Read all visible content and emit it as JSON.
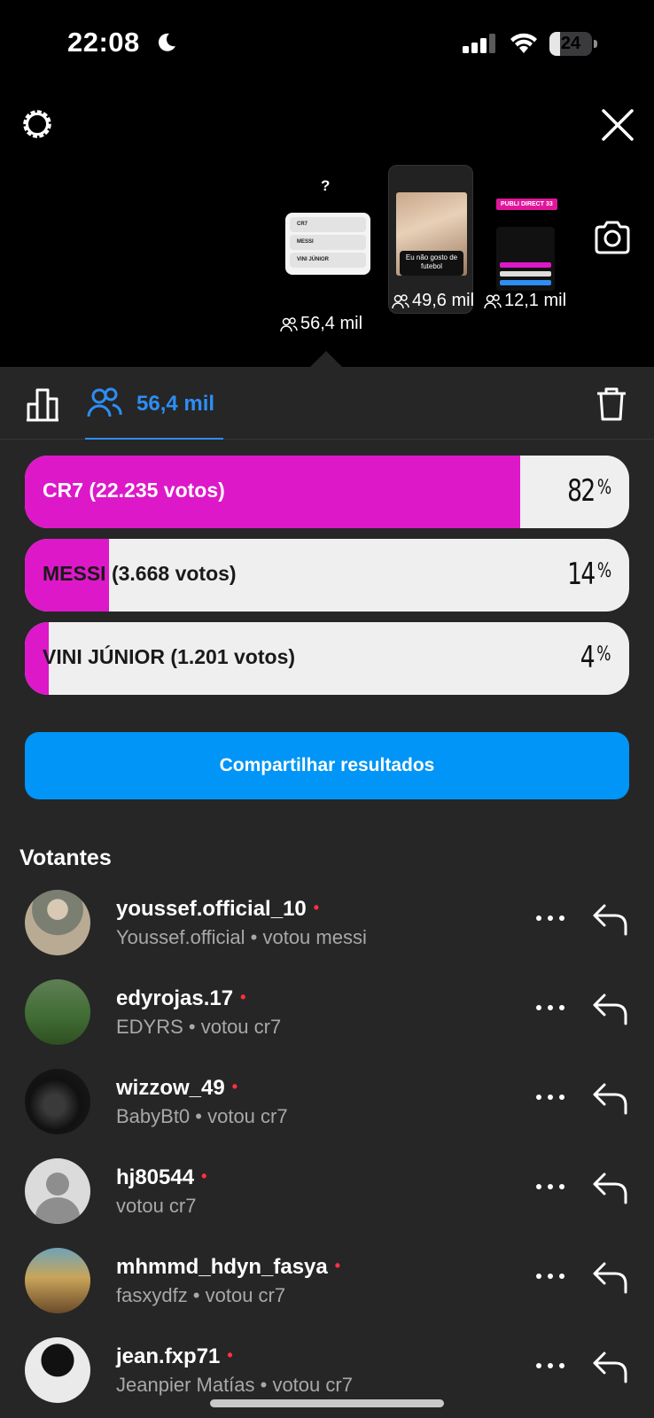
{
  "status_bar": {
    "time": "22:08",
    "battery_level": "24"
  },
  "story_thumbnails": [
    {
      "question_mark": "?",
      "poll_options": [
        "CR7",
        "MESSI",
        "VINI JÚNIOR"
      ],
      "viewers": "56,4 mil"
    },
    {
      "video_caption": "Eu não gosto de futebol",
      "viewers": "49,6 mil"
    },
    {
      "label": "PUBLI DIRECT 33",
      "viewers": "12,1 mil"
    }
  ],
  "tabs": {
    "voters_count": "56,4 mil"
  },
  "poll": {
    "options": [
      {
        "label": "CR7 (22.235 votos)",
        "percent": 82,
        "percent_text": "82",
        "votes": 22235
      },
      {
        "label": "MESSI (3.668 votos)",
        "percent": 14,
        "percent_text": "14",
        "votes": 3668
      },
      {
        "label": "VINI JÚNIOR (1.201 votos)",
        "percent": 4,
        "percent_text": "4",
        "votes": 1201
      }
    ],
    "percent_sign": "%",
    "share_button": "Compartilhar resultados",
    "fill_color": "#dd18c8"
  },
  "voters": {
    "title": "Votantes",
    "list": [
      {
        "username": "youssef.official_10",
        "subtitle": "Youssef.official • votou messi"
      },
      {
        "username": "edyrojas.17",
        "subtitle": "EDYRS • votou cr7"
      },
      {
        "username": "wizzow_49",
        "subtitle": "BabyBt0 • votou cr7"
      },
      {
        "username": "hj80544",
        "subtitle": "votou cr7"
      },
      {
        "username": "mhmmd_hdyn_fasya",
        "subtitle": "fasxydfz • votou cr7"
      },
      {
        "username": "jean.fxp71",
        "subtitle": "Jeanpier Matías • votou cr7"
      }
    ],
    "online_dot": "•"
  },
  "colors": {
    "accent_blue": "#0095f6",
    "tab_blue": "#2d8ef5",
    "online_red": "#ff3040",
    "panel_bg": "#262626"
  }
}
